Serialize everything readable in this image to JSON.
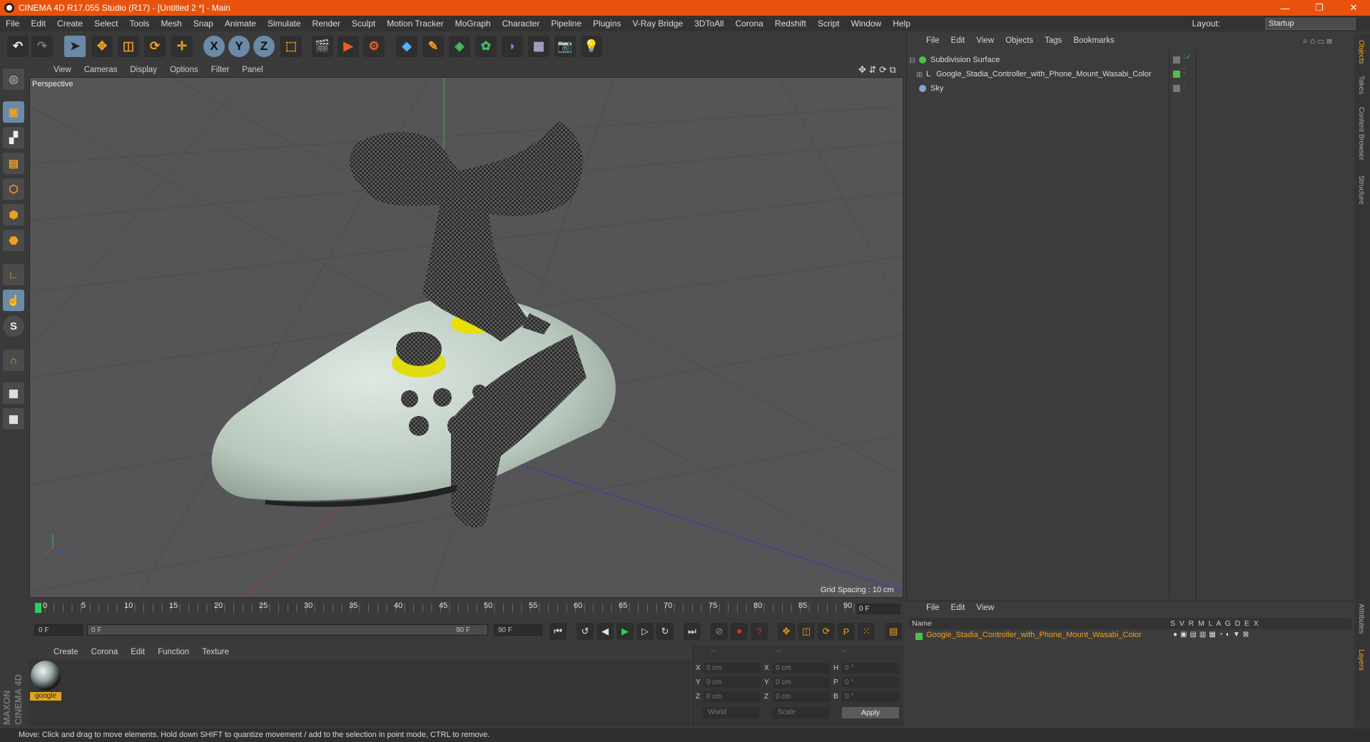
{
  "window": {
    "title": "CINEMA 4D R17.055 Studio (R17) - [Untitled 2 *] - Main",
    "controls": [
      "—",
      "❐",
      "✕"
    ]
  },
  "menubar": [
    "File",
    "Edit",
    "Create",
    "Select",
    "Tools",
    "Mesh",
    "Snap",
    "Animate",
    "Simulate",
    "Render",
    "Sculpt",
    "Motion Tracker",
    "MoGraph",
    "Character",
    "Pipeline",
    "Plugins",
    "V-Ray Bridge",
    "3DToAll",
    "Corona",
    "Redshift",
    "Script",
    "Window",
    "Help"
  ],
  "layout": {
    "label": "Layout:",
    "value": "Startup"
  },
  "toolbar": {
    "axis_x": "X",
    "axis_y": "Y",
    "axis_z": "Z"
  },
  "viewport": {
    "menu": [
      "View",
      "Cameras",
      "Display",
      "Options",
      "Filter",
      "Panel"
    ],
    "label": "Perspective",
    "grid_spacing": "Grid Spacing : 10 cm"
  },
  "timeline": {
    "ticks": [
      "0",
      "5",
      "10",
      "15",
      "20",
      "25",
      "30",
      "35",
      "40",
      "45",
      "50",
      "55",
      "60",
      "65",
      "70",
      "75",
      "80",
      "85",
      "90"
    ],
    "current_frame": "0 F",
    "start_field": "0 F",
    "range_start": "0 F",
    "range_end": "90 F",
    "end_field": "90 F"
  },
  "material_manager": {
    "menu": [
      "Create",
      "Corona",
      "Edit",
      "Function",
      "Texture"
    ],
    "material_name": "google"
  },
  "coordinates": {
    "headers": [
      "--",
      "--",
      "--"
    ],
    "rows": [
      {
        "a": "X",
        "pos": "0 cm",
        "b": "X",
        "size": "0 cm",
        "c": "H",
        "rot": "0 °"
      },
      {
        "a": "Y",
        "pos": "0 cm",
        "b": "Y",
        "size": "0 cm",
        "c": "P",
        "rot": "0 °"
      },
      {
        "a": "Z",
        "pos": "0 cm",
        "b": "Z",
        "size": "0 cm",
        "c": "B",
        "rot": "0 °"
      }
    ],
    "mode": "World",
    "scale_mode": "Scale",
    "apply": "Apply"
  },
  "status": "Move: Click and drag to move elements. Hold down SHIFT to quantize movement / add to the selection in point mode, CTRL to remove.",
  "object_manager": {
    "menu": [
      "File",
      "Edit",
      "View",
      "Objects",
      "Tags",
      "Bookmarks"
    ],
    "objects": [
      {
        "name": "Subdivision Surface",
        "color": "#4fc04f"
      },
      {
        "name": "Google_Stadia_Controller_with_Phone_Mount_Wasabi_Color",
        "color": "#cccccc"
      },
      {
        "name": "Sky",
        "color": "#7fa8d8"
      }
    ]
  },
  "layer_manager": {
    "menu": [
      "File",
      "Edit",
      "View"
    ],
    "head_name": "Name",
    "head_cols": "S  V  R  M  L  A  G  D  E  X",
    "layer": "Google_Stadia_Controller_with_Phone_Mount_Wasabi_Color"
  },
  "side_tabs": [
    "Objects",
    "Takes",
    "Content Browser",
    "Structure"
  ],
  "side_tabs_bottom": [
    "Attributes",
    "Layers"
  ],
  "brand": "MAXON CINEMA 4D"
}
